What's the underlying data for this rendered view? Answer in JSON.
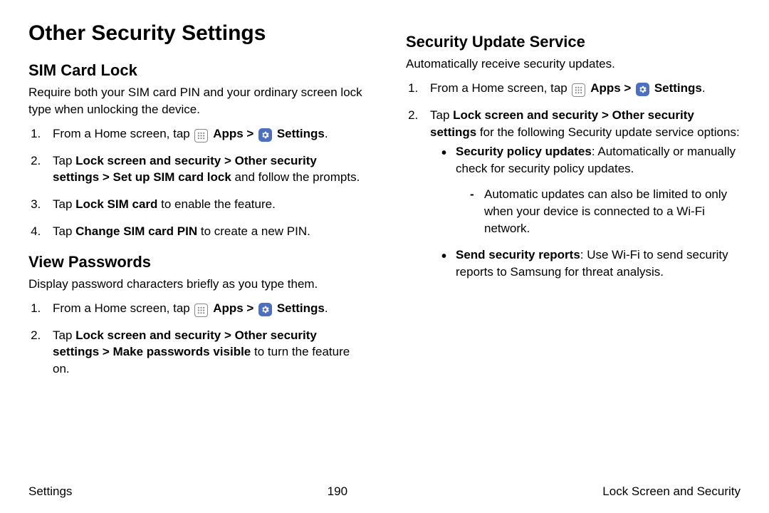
{
  "title": "Other Security Settings",
  "left": {
    "sim": {
      "heading": "SIM Card Lock",
      "intro": "Require both your SIM card PIN and your ordinary screen lock type when unlocking the device.",
      "step1_a": "From a Home screen, tap ",
      "apps": "Apps",
      "arrow": " > ",
      "settings": "Settings",
      "step1_end": ".",
      "step2_a": "Tap ",
      "step2_b": "Lock screen and security > Other security settings > Set up SIM card lock",
      "step2_c": " and follow the prompts.",
      "step3_a": "Tap ",
      "step3_b": "Lock SIM card",
      "step3_c": " to enable the feature.",
      "step4_a": "Tap ",
      "step4_b": "Change SIM card PIN",
      "step4_c": " to create a new PIN."
    },
    "view": {
      "heading": "View Passwords",
      "intro": "Display password characters briefly as you type them.",
      "step1_a": "From a Home screen, tap ",
      "apps": "Apps",
      "arrow": " > ",
      "settings": "Settings",
      "step1_end": ".",
      "step2_a": "Tap ",
      "step2_b": "Lock screen and security > Other security settings > Make passwords visible",
      "step2_c": " to turn the feature on."
    }
  },
  "right": {
    "sus": {
      "heading": "Security Update Service",
      "intro": "Automatically receive security updates.",
      "step1_a": "From a Home screen, tap ",
      "apps": "Apps",
      "arrow": " > ",
      "settings": "Settings",
      "step1_end": ".",
      "step2_a": "Tap ",
      "step2_b": "Lock screen and security > Other security settings",
      "step2_c": " for the following Security update service options:",
      "b1_a": "Security policy updates",
      "b1_b": ": Automatically or manually check for security policy updates.",
      "b1_sub": "Automatic updates can also be limited to only when your device is connected to a Wi-Fi network.",
      "b2_a": "Send security reports",
      "b2_b": ": Use Wi-Fi to send security reports to Samsung for threat analysis."
    }
  },
  "footer": {
    "left": "Settings",
    "center": "190",
    "right": "Lock Screen and Security"
  }
}
